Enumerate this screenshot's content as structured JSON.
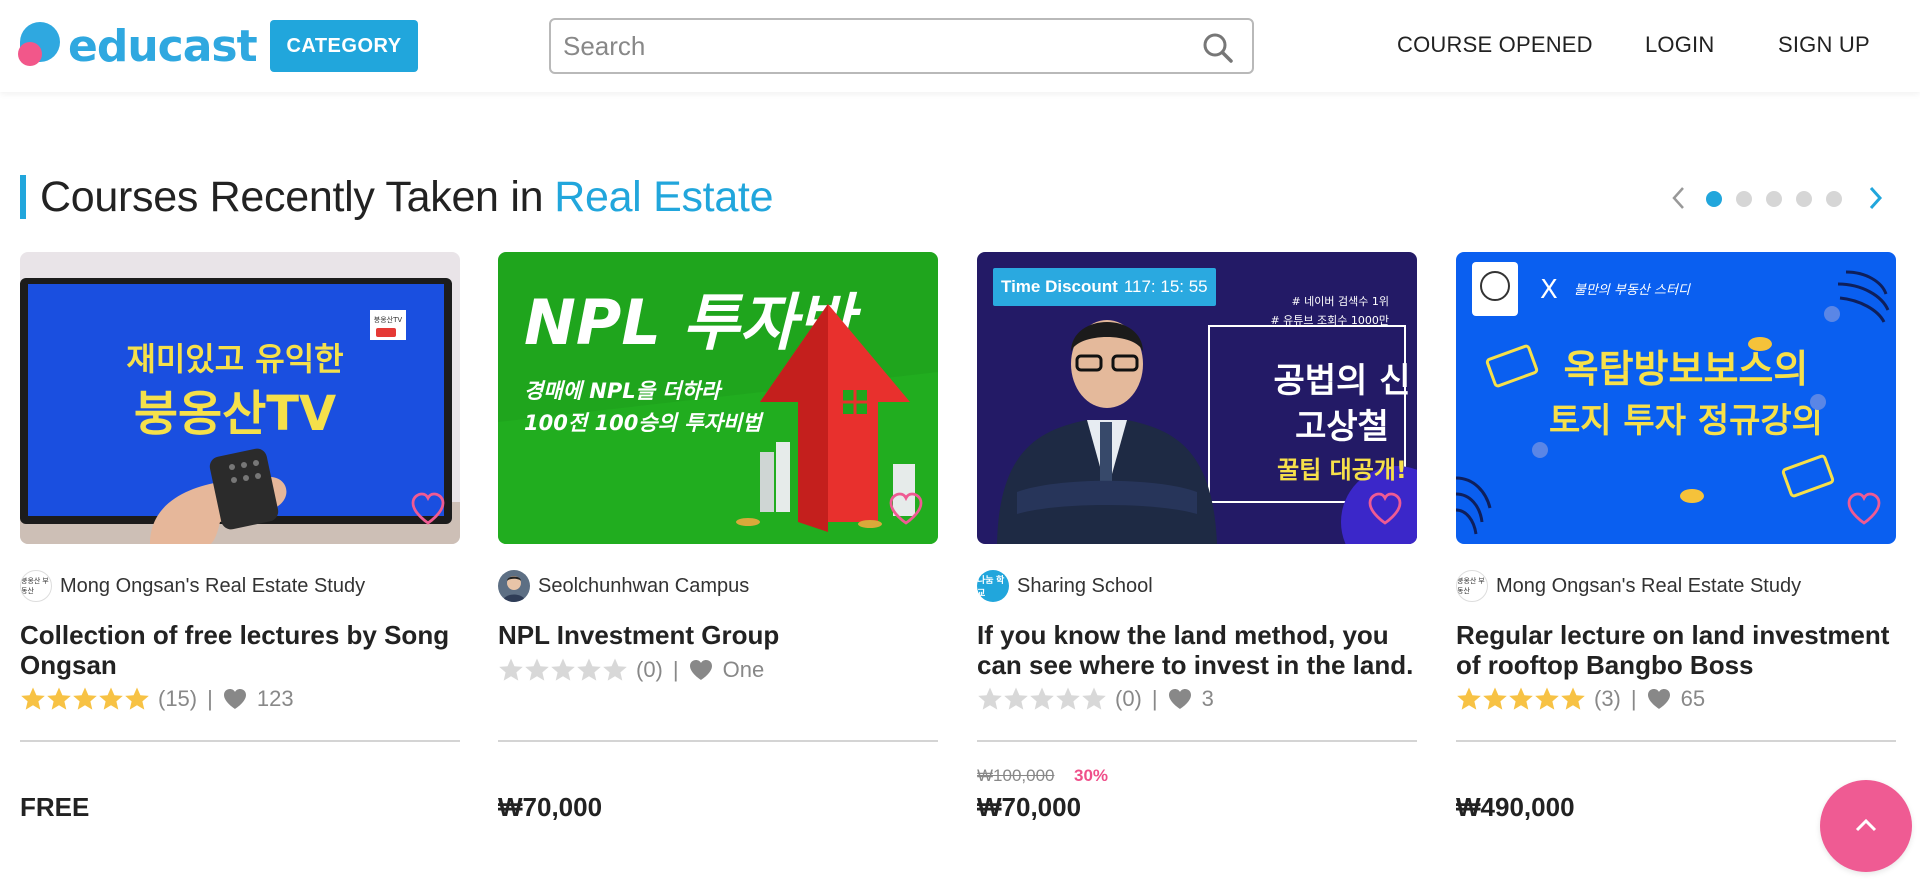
{
  "header": {
    "logo_text": "educast",
    "category_label": "CATEGORY",
    "search_placeholder": "Search",
    "nav": {
      "course_opened": "COURSE OPENED",
      "login": "LOGIN",
      "signup": "SIGN UP"
    }
  },
  "section": {
    "title_prefix": "Courses Recently Taken in",
    "title_accent": "Real Estate",
    "page_count": 5,
    "active_page": 1
  },
  "thumbnails": {
    "card1": {
      "line1": "재미있고 유익한",
      "line2": "붕옹산TV",
      "corner_logo": "붕옹산TV"
    },
    "card2": {
      "headline": "NPL 투자반",
      "sub1": "경매에 NPL을 더하라",
      "sub2": "100전 100승의 투자비법"
    },
    "card3": {
      "tag1": "# 네이버 검색수 1위",
      "tag2": "# 유튜브 조회수 1000만",
      "line1": "공법의 신",
      "line2": "고상철",
      "line3": "꿀팁 대공개!",
      "badge_label": "Time Discount",
      "badge_time": "117: 15: 55"
    },
    "card4": {
      "collab": "X",
      "script": "불만의 부동산 스터디",
      "line1": "옥탑방보보스의",
      "line2": "토지 투자 정규강의"
    }
  },
  "courses": [
    {
      "provider": "Mong Ongsan's Real Estate Study",
      "provider_logo": "붕옹산 부동산",
      "title": "Collection of free lectures by Song Ongsan",
      "stars": 5,
      "reviews": "(15)",
      "likes": "123",
      "original_price": "",
      "discount": "",
      "price": "FREE"
    },
    {
      "provider": "Seolchunhwan Campus",
      "provider_logo": "",
      "title": "NPL Investment Group",
      "stars": 0,
      "reviews": "(0)",
      "likes": "One",
      "original_price": "",
      "discount": "",
      "price": "₩70,000"
    },
    {
      "provider": "Sharing School",
      "provider_logo": "나눔 학교",
      "title": "If you know the land method, you can see where to invest in the land.",
      "stars": 0,
      "reviews": "(0)",
      "likes": "3",
      "original_price": "₩100,000",
      "discount": "30%",
      "price": "₩70,000"
    },
    {
      "provider": "Mong Ongsan's Real Estate Study",
      "provider_logo": "붕옹산 부동산",
      "title": "Regular lecture on land investment of rooftop Bangbo Boss",
      "stars": 5,
      "reviews": "(3)",
      "likes": "65",
      "original_price": "",
      "discount": "",
      "price": "₩490,000"
    }
  ],
  "colors": {
    "brand_blue": "#21a6dc",
    "brand_pink": "#ef5b93",
    "star_gold": "#f7c244",
    "star_empty": "#d8d8d8"
  },
  "icons": {
    "search": "search-icon",
    "prev": "chevron-left-icon",
    "next": "chevron-right-icon",
    "wish": "heart-outline-icon",
    "like": "heart-icon",
    "top": "chevron-up-icon"
  }
}
